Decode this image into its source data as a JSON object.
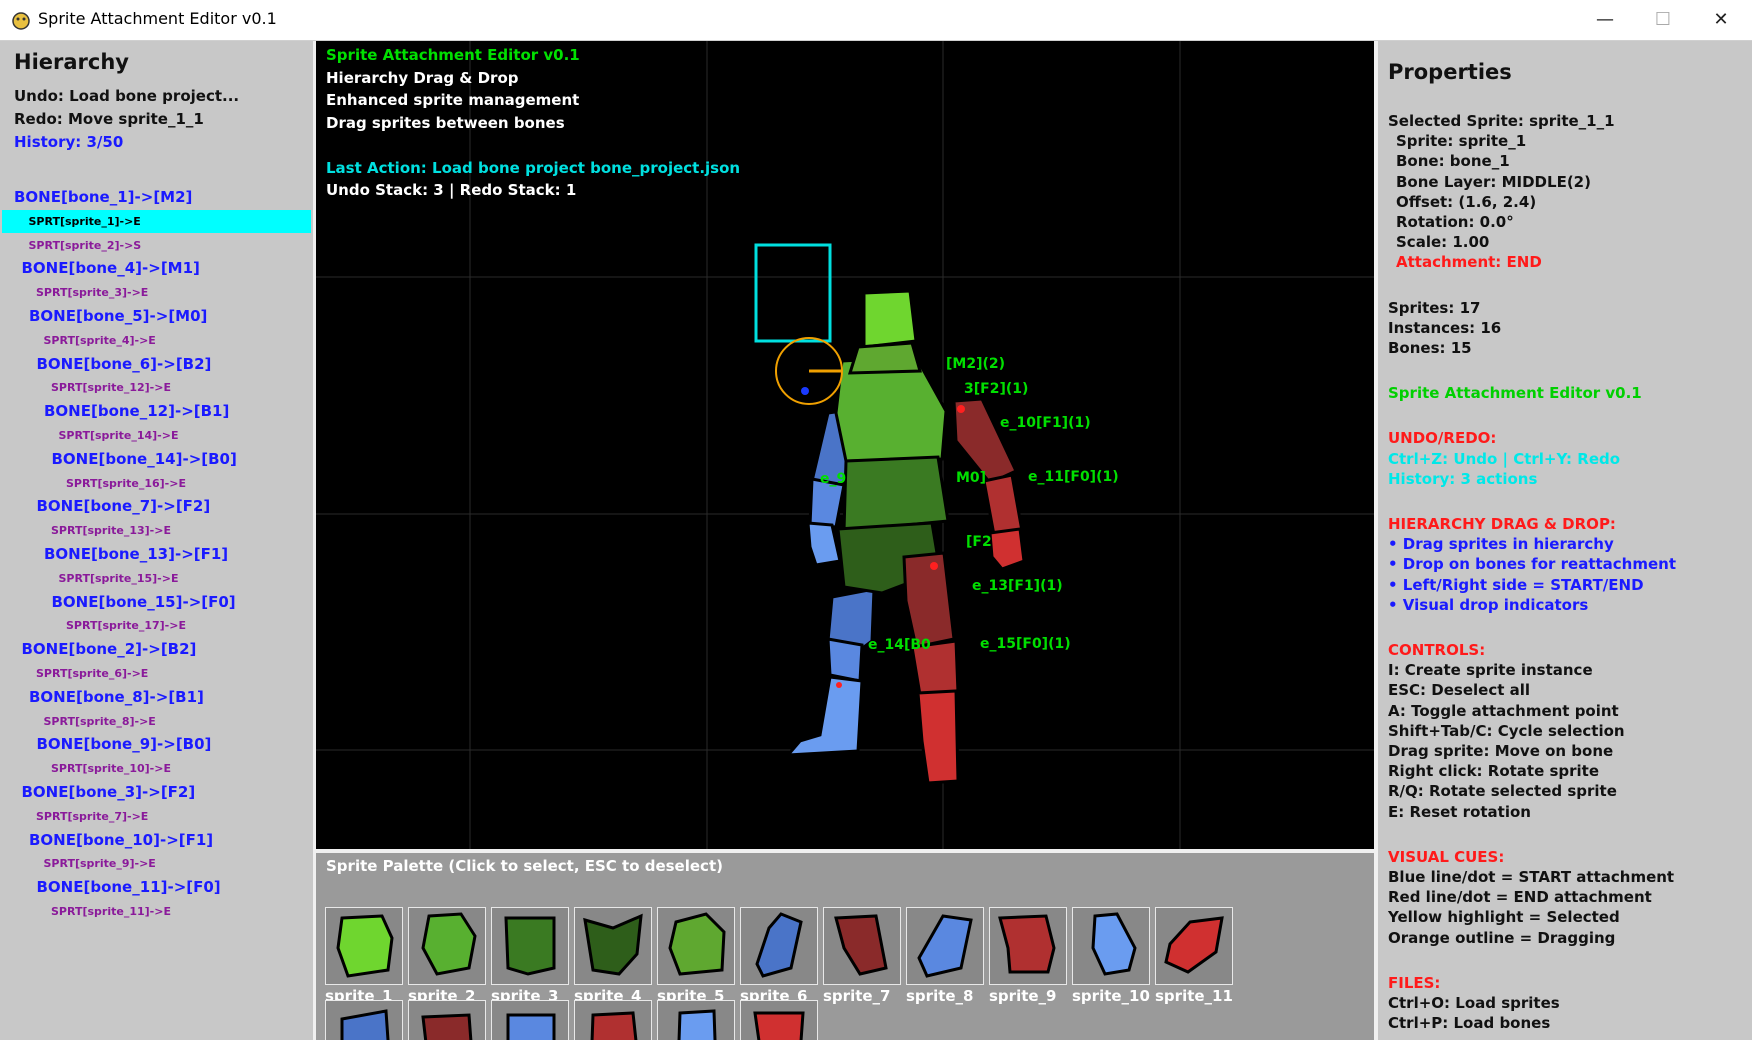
{
  "window": {
    "title": "Sprite Attachment Editor v0.1",
    "minimize": "—",
    "maximize": "☐",
    "close": "✕"
  },
  "hierarchy": {
    "title": "Hierarchy",
    "undo": "Undo: Load bone project...",
    "redo": "Redo: Move sprite_1_1",
    "history": "History: 3/50",
    "items": [
      {
        "text": "BONE[bone_1]->[M2]",
        "kind": "bone",
        "indent": 0,
        "selected": false
      },
      {
        "text": "SPRT[sprite_1]->E",
        "kind": "sprite",
        "indent": 1,
        "selected": true
      },
      {
        "text": "SPRT[sprite_2]->S",
        "kind": "sprite",
        "indent": 1,
        "selected": false
      },
      {
        "text": "BONE[bone_4]->[M1]",
        "kind": "bone",
        "indent": 1,
        "selected": false
      },
      {
        "text": "SPRT[sprite_3]->E",
        "kind": "sprite",
        "indent": 2,
        "selected": false
      },
      {
        "text": "BONE[bone_5]->[M0]",
        "kind": "bone",
        "indent": 2,
        "selected": false
      },
      {
        "text": "SPRT[sprite_4]->E",
        "kind": "sprite",
        "indent": 3,
        "selected": false
      },
      {
        "text": "BONE[bone_6]->[B2]",
        "kind": "bone",
        "indent": 3,
        "selected": false
      },
      {
        "text": "SPRT[sprite_12]->E",
        "kind": "sprite",
        "indent": 4,
        "selected": false
      },
      {
        "text": "BONE[bone_12]->[B1]",
        "kind": "bone",
        "indent": 4,
        "selected": false
      },
      {
        "text": "SPRT[sprite_14]->E",
        "kind": "sprite",
        "indent": 5,
        "selected": false
      },
      {
        "text": "BONE[bone_14]->[B0]",
        "kind": "bone",
        "indent": 5,
        "selected": false
      },
      {
        "text": "SPRT[sprite_16]->E",
        "kind": "sprite",
        "indent": 6,
        "selected": false
      },
      {
        "text": "BONE[bone_7]->[F2]",
        "kind": "bone",
        "indent": 3,
        "selected": false
      },
      {
        "text": "SPRT[sprite_13]->E",
        "kind": "sprite",
        "indent": 4,
        "selected": false
      },
      {
        "text": "BONE[bone_13]->[F1]",
        "kind": "bone",
        "indent": 4,
        "selected": false
      },
      {
        "text": "SPRT[sprite_15]->E",
        "kind": "sprite",
        "indent": 5,
        "selected": false
      },
      {
        "text": "BONE[bone_15]->[F0]",
        "kind": "bone",
        "indent": 5,
        "selected": false
      },
      {
        "text": "SPRT[sprite_17]->E",
        "kind": "sprite",
        "indent": 6,
        "selected": false
      },
      {
        "text": "BONE[bone_2]->[B2]",
        "kind": "bone",
        "indent": 1,
        "selected": false
      },
      {
        "text": "SPRT[sprite_6]->E",
        "kind": "sprite",
        "indent": 2,
        "selected": false
      },
      {
        "text": "BONE[bone_8]->[B1]",
        "kind": "bone",
        "indent": 2,
        "selected": false
      },
      {
        "text": "SPRT[sprite_8]->E",
        "kind": "sprite",
        "indent": 3,
        "selected": false
      },
      {
        "text": "BONE[bone_9]->[B0]",
        "kind": "bone",
        "indent": 3,
        "selected": false
      },
      {
        "text": "SPRT[sprite_10]->E",
        "kind": "sprite",
        "indent": 4,
        "selected": false
      },
      {
        "text": "BONE[bone_3]->[F2]",
        "kind": "bone",
        "indent": 1,
        "selected": false
      },
      {
        "text": "SPRT[sprite_7]->E",
        "kind": "sprite",
        "indent": 2,
        "selected": false
      },
      {
        "text": "BONE[bone_10]->[F1]",
        "kind": "bone",
        "indent": 2,
        "selected": false
      },
      {
        "text": "SPRT[sprite_9]->E",
        "kind": "sprite",
        "indent": 3,
        "selected": false
      },
      {
        "text": "BONE[bone_11]->[F0]",
        "kind": "bone",
        "indent": 3,
        "selected": false
      },
      {
        "text": "SPRT[sprite_11]->E",
        "kind": "sprite",
        "indent": 4,
        "selected": false
      }
    ]
  },
  "viewport": {
    "info": [
      {
        "text": "Sprite Attachment Editor v0.1",
        "color": "#00e000"
      },
      {
        "text": "Hierarchy Drag & Drop",
        "color": "#ffffff"
      },
      {
        "text": "Enhanced sprite management",
        "color": "#ffffff"
      },
      {
        "text": "Drag sprites between bones",
        "color": "#ffffff"
      },
      {
        "text": "",
        "color": "#ffffff"
      },
      {
        "text": "Last Action: Load bone project bone_project.json",
        "color": "#00e0e0"
      },
      {
        "text": "Undo Stack: 3 | Redo Stack: 1",
        "color": "#ffffff"
      }
    ],
    "bone_labels": [
      "[M2](2)",
      "3[F2](1)",
      "e_10[F1](1)",
      "e_9",
      "M0]",
      "e_11[F0](1)",
      "[F2",
      "e_13[F1](1)",
      "e_14[B0",
      "e_15[F0](1)"
    ]
  },
  "palette": {
    "title": "Sprite Palette (Click to select, ESC to deselect)",
    "sprites": [
      {
        "name": "sprite_1",
        "color": "#6fd62f"
      },
      {
        "name": "sprite_2",
        "color": "#58b030"
      },
      {
        "name": "sprite_3",
        "color": "#3a7a22"
      },
      {
        "name": "sprite_4",
        "color": "#2e5e1a"
      },
      {
        "name": "sprite_5",
        "color": "#5fa830"
      },
      {
        "name": "sprite_6",
        "color": "#4a74c8"
      },
      {
        "name": "sprite_7",
        "color": "#8a2a2a"
      },
      {
        "name": "sprite_8",
        "color": "#5a88e0"
      },
      {
        "name": "sprite_9",
        "color": "#b03030"
      },
      {
        "name": "sprite_10",
        "color": "#6a9cf0"
      },
      {
        "name": "sprite_11",
        "color": "#d03030"
      },
      {
        "name": "",
        "color": "#4a74c8"
      },
      {
        "name": "",
        "color": "#8a2a2a"
      },
      {
        "name": "",
        "color": "#5a88e0"
      },
      {
        "name": "",
        "color": "#b03030"
      },
      {
        "name": "",
        "color": "#6a9cf0"
      },
      {
        "name": "",
        "color": "#d03030"
      }
    ]
  },
  "properties": {
    "title": "Properties",
    "lines": [
      {
        "text": "Selected Sprite: sprite_1_1",
        "color": "#111111",
        "indent": 0,
        "gap": 0
      },
      {
        "text": "Sprite: sprite_1",
        "color": "#111111",
        "indent": 1,
        "gap": 0
      },
      {
        "text": "Bone: bone_1",
        "color": "#111111",
        "indent": 1,
        "gap": 0
      },
      {
        "text": "Bone Layer: MIDDLE(2)",
        "color": "#111111",
        "indent": 1,
        "gap": 0
      },
      {
        "text": "Offset: (1.6, 2.4)",
        "color": "#111111",
        "indent": 1,
        "gap": 0
      },
      {
        "text": "Rotation: 0.0°",
        "color": "#111111",
        "indent": 1,
        "gap": 0
      },
      {
        "text": "Scale: 1.00",
        "color": "#111111",
        "indent": 1,
        "gap": 0
      },
      {
        "text": "Attachment: END",
        "color": "#ff1a1a",
        "indent": 1,
        "gap": 0
      },
      {
        "text": "Sprites: 17",
        "color": "#111111",
        "indent": 0,
        "gap": 1
      },
      {
        "text": "Instances: 16",
        "color": "#111111",
        "indent": 0,
        "gap": 0
      },
      {
        "text": "Bones: 15",
        "color": "#111111",
        "indent": 0,
        "gap": 0
      },
      {
        "text": "Sprite Attachment Editor v0.1",
        "color": "#00d000",
        "indent": 0,
        "gap": 1
      },
      {
        "text": "UNDO/REDO:",
        "color": "#ff1a1a",
        "indent": 0,
        "gap": 1
      },
      {
        "text": "Ctrl+Z: Undo | Ctrl+Y: Redo",
        "color": "#00e8e8",
        "indent": 0,
        "gap": 0
      },
      {
        "text": "History: 3 actions",
        "color": "#00e8e8",
        "indent": 0,
        "gap": 0
      },
      {
        "text": "HIERARCHY DRAG & DROP:",
        "color": "#ff1a1a",
        "indent": 0,
        "gap": 1
      },
      {
        "text": "• Drag sprites in hierarchy",
        "color": "#1a1aff",
        "indent": 0,
        "gap": 0
      },
      {
        "text": "• Drop on bones for reattachment",
        "color": "#1a1aff",
        "indent": 0,
        "gap": 0
      },
      {
        "text": "• Left/Right side = START/END",
        "color": "#1a1aff",
        "indent": 0,
        "gap": 0
      },
      {
        "text": "• Visual drop indicators",
        "color": "#1a1aff",
        "indent": 0,
        "gap": 0
      },
      {
        "text": "CONTROLS:",
        "color": "#ff1a1a",
        "indent": 0,
        "gap": 1
      },
      {
        "text": "I: Create sprite instance",
        "color": "#111111",
        "indent": 0,
        "gap": 0
      },
      {
        "text": "ESC: Deselect all",
        "color": "#111111",
        "indent": 0,
        "gap": 0
      },
      {
        "text": "A: Toggle attachment point",
        "color": "#111111",
        "indent": 0,
        "gap": 0
      },
      {
        "text": "Shift+Tab/C: Cycle selection",
        "color": "#111111",
        "indent": 0,
        "gap": 0
      },
      {
        "text": "Drag sprite: Move on bone",
        "color": "#111111",
        "indent": 0,
        "gap": 0
      },
      {
        "text": "Right click: Rotate sprite",
        "color": "#111111",
        "indent": 0,
        "gap": 0
      },
      {
        "text": "R/Q: Rotate selected sprite",
        "color": "#111111",
        "indent": 0,
        "gap": 0
      },
      {
        "text": "E: Reset rotation",
        "color": "#111111",
        "indent": 0,
        "gap": 0
      },
      {
        "text": "VISUAL CUES:",
        "color": "#ff1a1a",
        "indent": 0,
        "gap": 1
      },
      {
        "text": "Blue line/dot = START attachment",
        "color": "#111111",
        "indent": 0,
        "gap": 0
      },
      {
        "text": "Red line/dot = END attachment",
        "color": "#111111",
        "indent": 0,
        "gap": 0
      },
      {
        "text": "Yellow highlight = Selected",
        "color": "#111111",
        "indent": 0,
        "gap": 0
      },
      {
        "text": "Orange outline = Dragging",
        "color": "#111111",
        "indent": 0,
        "gap": 0
      },
      {
        "text": "FILES:",
        "color": "#ff1a1a",
        "indent": 0,
        "gap": 1
      },
      {
        "text": "Ctrl+O: Load sprites",
        "color": "#111111",
        "indent": 0,
        "gap": 0
      },
      {
        "text": "Ctrl+P: Load bones",
        "color": "#111111",
        "indent": 0,
        "gap": 0
      }
    ]
  }
}
